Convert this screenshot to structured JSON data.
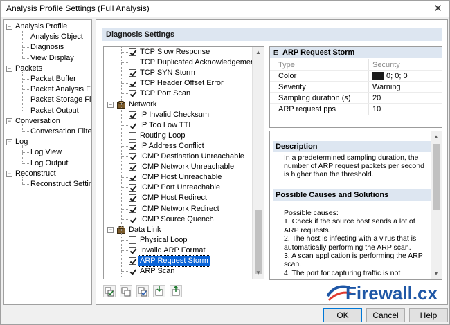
{
  "window": {
    "title": "Analysis Profile Settings (Full Analysis)",
    "close_glyph": "✕"
  },
  "nav": {
    "items": [
      {
        "label": "Analysis Profile",
        "level": 0,
        "expanded": true
      },
      {
        "label": "Analysis Object",
        "level": 1
      },
      {
        "label": "Diagnosis",
        "level": 1,
        "selected": true
      },
      {
        "label": "View Display",
        "level": 1
      },
      {
        "label": "Packets",
        "level": 0,
        "expanded": true
      },
      {
        "label": "Packet Buffer",
        "level": 1
      },
      {
        "label": "Packet Analysis Filte",
        "level": 1
      },
      {
        "label": "Packet Storage Filte",
        "level": 1
      },
      {
        "label": "Packet Output",
        "level": 1
      },
      {
        "label": "Conversation",
        "level": 0,
        "expanded": true
      },
      {
        "label": "Conversation Filter",
        "level": 1
      },
      {
        "label": "Log",
        "level": 0,
        "expanded": true
      },
      {
        "label": "Log View",
        "level": 1
      },
      {
        "label": "Log Output",
        "level": 1
      },
      {
        "label": "Reconstruct",
        "level": 0,
        "expanded": true
      },
      {
        "label": "Reconstruct Setting",
        "level": 1
      }
    ]
  },
  "main": {
    "section_title": "Diagnosis Settings"
  },
  "checklist": [
    {
      "type": "item",
      "label": "TCP Slow Response",
      "checked": true
    },
    {
      "type": "item",
      "label": "TCP Duplicated Acknowledgement",
      "checked": false
    },
    {
      "type": "item",
      "label": "TCP SYN Storm",
      "checked": true
    },
    {
      "type": "item",
      "label": "TCP Header Offset Error",
      "checked": true
    },
    {
      "type": "item",
      "label": "TCP Port Scan",
      "checked": true
    },
    {
      "type": "category",
      "label": "Network"
    },
    {
      "type": "item",
      "label": "IP Invalid Checksum",
      "checked": true
    },
    {
      "type": "item",
      "label": "IP Too Low TTL",
      "checked": true
    },
    {
      "type": "item",
      "label": "Routing Loop",
      "checked": false
    },
    {
      "type": "item",
      "label": "IP Address Conflict",
      "checked": true
    },
    {
      "type": "item",
      "label": "ICMP Destination Unreachable",
      "checked": true
    },
    {
      "type": "item",
      "label": "ICMP Network Unreachable",
      "checked": true
    },
    {
      "type": "item",
      "label": "ICMP Host Unreachable",
      "checked": true
    },
    {
      "type": "item",
      "label": "ICMP Port Unreachable",
      "checked": true
    },
    {
      "type": "item",
      "label": "ICMP Host Redirect",
      "checked": true
    },
    {
      "type": "item",
      "label": "ICMP Network Redirect",
      "checked": true
    },
    {
      "type": "item",
      "label": "ICMP Source Quench",
      "checked": true
    },
    {
      "type": "category",
      "label": "Data Link"
    },
    {
      "type": "item",
      "label": "Physical Loop",
      "checked": false
    },
    {
      "type": "item",
      "label": "Invalid ARP Format",
      "checked": true
    },
    {
      "type": "item",
      "label": "ARP Request Storm",
      "checked": true,
      "selected": true
    },
    {
      "type": "item",
      "label": "ARP Scan",
      "checked": true
    }
  ],
  "properties": {
    "title": "ARP Request Storm",
    "rows": [
      {
        "key": "Type",
        "value": "Security",
        "muted": true
      },
      {
        "key": "Color",
        "value": "0; 0; 0",
        "swatch": "#1a1a1a"
      },
      {
        "key": "Severity",
        "value": "Warning"
      },
      {
        "key": "Sampling duration (s)",
        "value": "20"
      },
      {
        "key": "ARP request pps",
        "value": "10"
      }
    ]
  },
  "description": {
    "heading": "Description",
    "text_lines": [
      "In a predetermined sampling duration, the",
      "number of ARP request packets per second",
      "is higher than the threshold."
    ],
    "causes_heading": "Possible Causes and Solutions",
    "causes_lines": [
      "Possible causes:",
      "1. Check if the source host sends a lot of",
      "ARP requests.",
      "2. The host is infecting with a virus that is",
      "automatically performing the ARP scan.",
      "3. A scan application is performing the ARP",
      "scan.",
      "4. The port for capturing traffic is not"
    ]
  },
  "toolbar": {
    "buttons": [
      {
        "name": "check-all-button",
        "icon": "check-all-icon"
      },
      {
        "name": "uncheck-all-button",
        "icon": "uncheck-all-icon"
      },
      {
        "name": "reset-default-button",
        "icon": "reset-icon"
      },
      {
        "name": "import-button",
        "icon": "import-icon"
      },
      {
        "name": "export-button",
        "icon": "export-icon"
      }
    ]
  },
  "watermark": {
    "text": "Firewall.cx",
    "colors": {
      "primary": "#1f57a6",
      "accent": "#e03a2f"
    }
  },
  "buttons": {
    "ok": "OK",
    "cancel": "Cancel",
    "help": "Help"
  },
  "colors": {
    "selection": "#0a64d8",
    "section_header": "#dde6f1"
  }
}
